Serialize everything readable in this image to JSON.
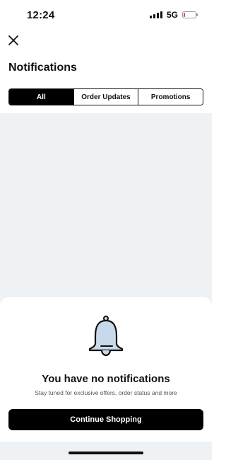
{
  "status_bar": {
    "time": "12:24",
    "network": "5G",
    "battery_level": 0.1
  },
  "header": {
    "close_icon": "close-icon",
    "title": "Notifications"
  },
  "tabs": [
    {
      "label": "All",
      "active": true
    },
    {
      "label": "Order Updates",
      "active": false
    },
    {
      "label": "Promotions",
      "active": false
    }
  ],
  "empty_state": {
    "icon": "bell-icon",
    "title": "You have no notifications",
    "subtitle": "Stay tuned for exclusive offers, order status and more",
    "button_label": "Continue Shopping"
  },
  "colors": {
    "backdrop": "#eff2f5",
    "primary": "#000000",
    "bell_fill": "#c9d9ec",
    "battery_low": "#e5484d"
  }
}
